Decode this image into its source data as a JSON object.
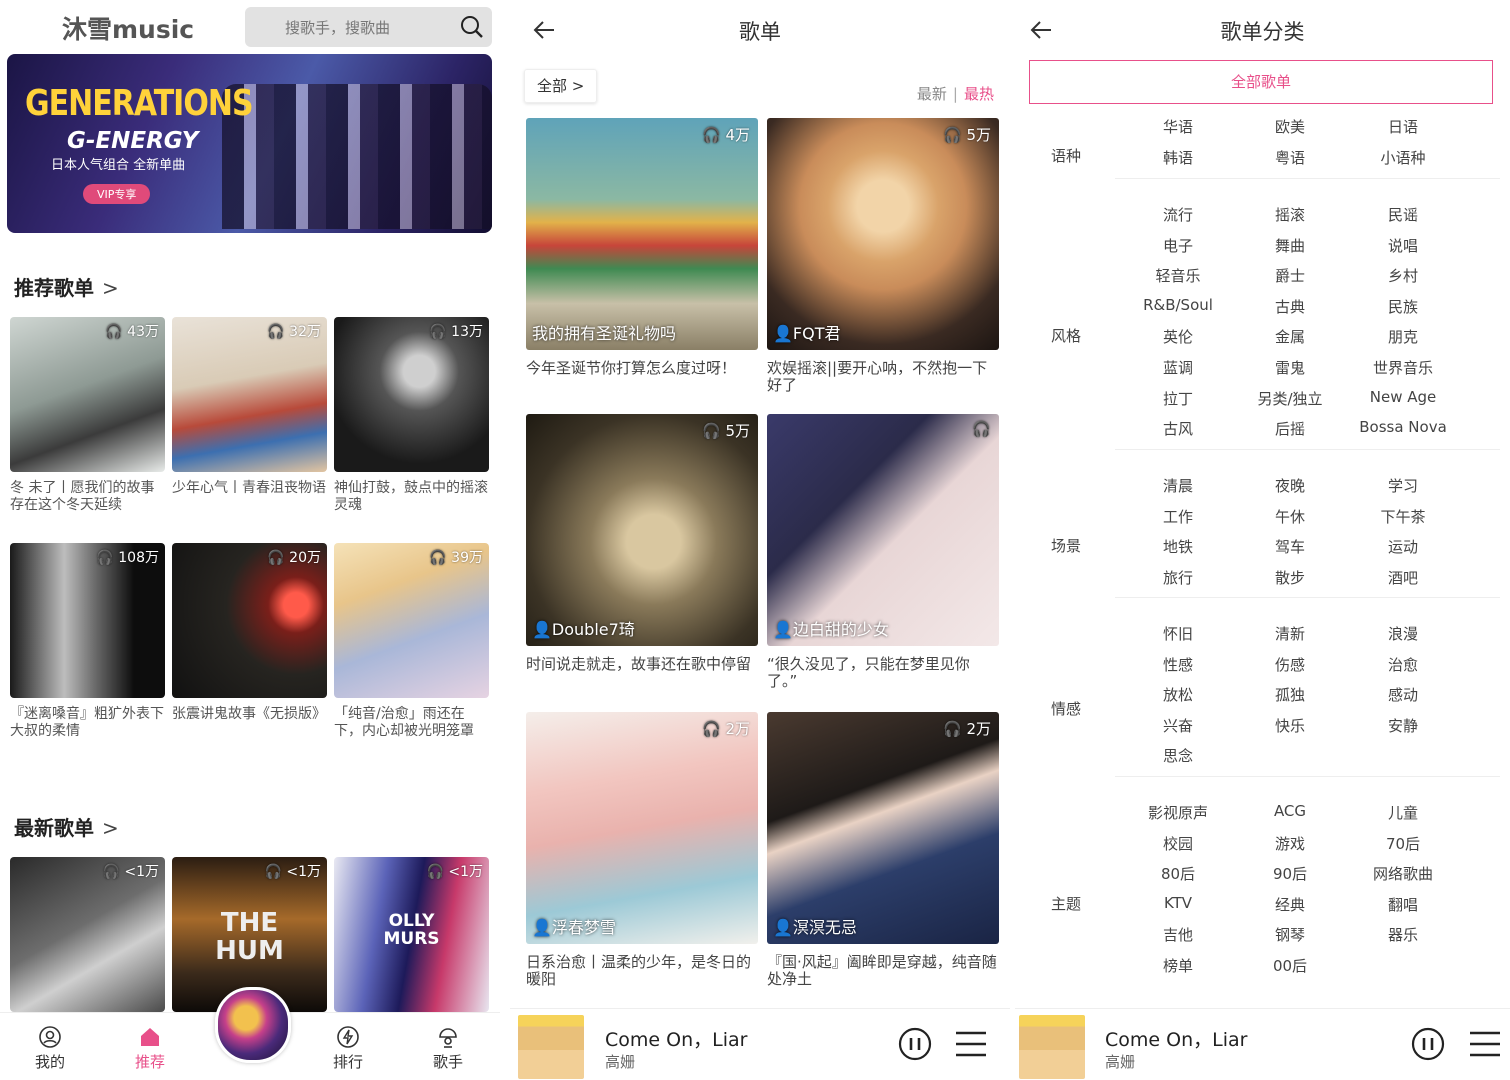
{
  "panel1": {
    "brand": "沐雪music",
    "search_placeholder": "搜歌手，搜歌曲",
    "banner": {
      "title": "GENERATIONS",
      "subtitle": "G-ENERGY",
      "tagline": "日本人气组合 全新单曲",
      "vip": "VIP专享"
    },
    "recommend_title": "推荐歌单",
    "recommend": [
      {
        "count": "43万",
        "desc": "冬 未了丨愿我们的故事存在这个冬天延续"
      },
      {
        "count": "32万",
        "desc": "少年心气丨青春沮丧物语"
      },
      {
        "count": "13万",
        "desc": "神仙打鼓，鼓点中的摇滚灵魂"
      },
      {
        "count": "108万",
        "desc": "『迷离嗓音』粗犷外表下大叔的柔情"
      },
      {
        "count": "20万",
        "desc": "张震讲鬼故事《无损版》"
      },
      {
        "count": "39万",
        "desc": "「纯音/治愈」雨还在下，内心却被光明笼罩"
      }
    ],
    "latest_title": "最新歌单",
    "latest": [
      {
        "count": "<1万",
        "text": ""
      },
      {
        "count": "<1万",
        "text": "THE HUM"
      },
      {
        "count": "<1万",
        "text": "OLLY MURS"
      }
    ],
    "nav": [
      "我的",
      "推荐",
      "排行",
      "歌手"
    ]
  },
  "panel2": {
    "title": "歌单",
    "filter": "全部",
    "sort_latest": "最新",
    "sort_hot": "最热",
    "playlists": [
      {
        "count": "4万",
        "owner": "我的拥有圣诞礼物吗",
        "desc": "今年圣诞节你打算怎么度过呀！"
      },
      {
        "count": "5万",
        "owner": "FQT君",
        "desc": "欢娱摇滚||要开心呐，不然抱一下好了"
      },
      {
        "count": "5万",
        "owner": "Double7琦",
        "desc": "时间说走就走，故事还在歌中停留"
      },
      {
        "count": "",
        "owner": "边白甜的少女",
        "desc": "“很久没见了，只能在梦里见你了。”"
      },
      {
        "count": "2万",
        "owner": "浮春梦雪",
        "desc": "日系治愈丨温柔的少年，是冬日的暖阳"
      },
      {
        "count": "2万",
        "owner": "溟溟无忌",
        "desc": "『国·风起』阖眸即是穿越，纯音随处净土"
      }
    ]
  },
  "panel3": {
    "title": "歌单分类",
    "all": "全部歌单",
    "groups": [
      {
        "name": "语种",
        "tags": [
          "华语",
          "欧美",
          "日语",
          "韩语",
          "粤语",
          "小语种"
        ]
      },
      {
        "name": "风格",
        "tags": [
          "流行",
          "摇滚",
          "民谣",
          "电子",
          "舞曲",
          "说唱",
          "轻音乐",
          "爵士",
          "乡村",
          "R&B/Soul",
          "古典",
          "民族",
          "英伦",
          "金属",
          "朋克",
          "蓝调",
          "雷鬼",
          "世界音乐",
          "拉丁",
          "另类/独立",
          "New Age",
          "古风",
          "后摇",
          "Bossa Nova"
        ]
      },
      {
        "name": "场景",
        "tags": [
          "清晨",
          "夜晚",
          "学习",
          "工作",
          "午休",
          "下午茶",
          "地铁",
          "驾车",
          "运动",
          "旅行",
          "散步",
          "酒吧"
        ]
      },
      {
        "name": "情感",
        "tags": [
          "怀旧",
          "清新",
          "浪漫",
          "性感",
          "伤感",
          "治愈",
          "放松",
          "孤独",
          "感动",
          "兴奋",
          "快乐",
          "安静",
          "思念"
        ]
      },
      {
        "name": "主题",
        "tags": [
          "影视原声",
          "ACG",
          "儿童",
          "校园",
          "游戏",
          "70后",
          "80后",
          "90后",
          "网络歌曲",
          "KTV",
          "经典",
          "翻唱",
          "吉他",
          "钢琴",
          "器乐",
          "榜单",
          "00后"
        ]
      }
    ]
  },
  "player": {
    "song": "Come On，Liar",
    "artist": "高姗"
  },
  "colors": {
    "accent": "#e8508a"
  }
}
